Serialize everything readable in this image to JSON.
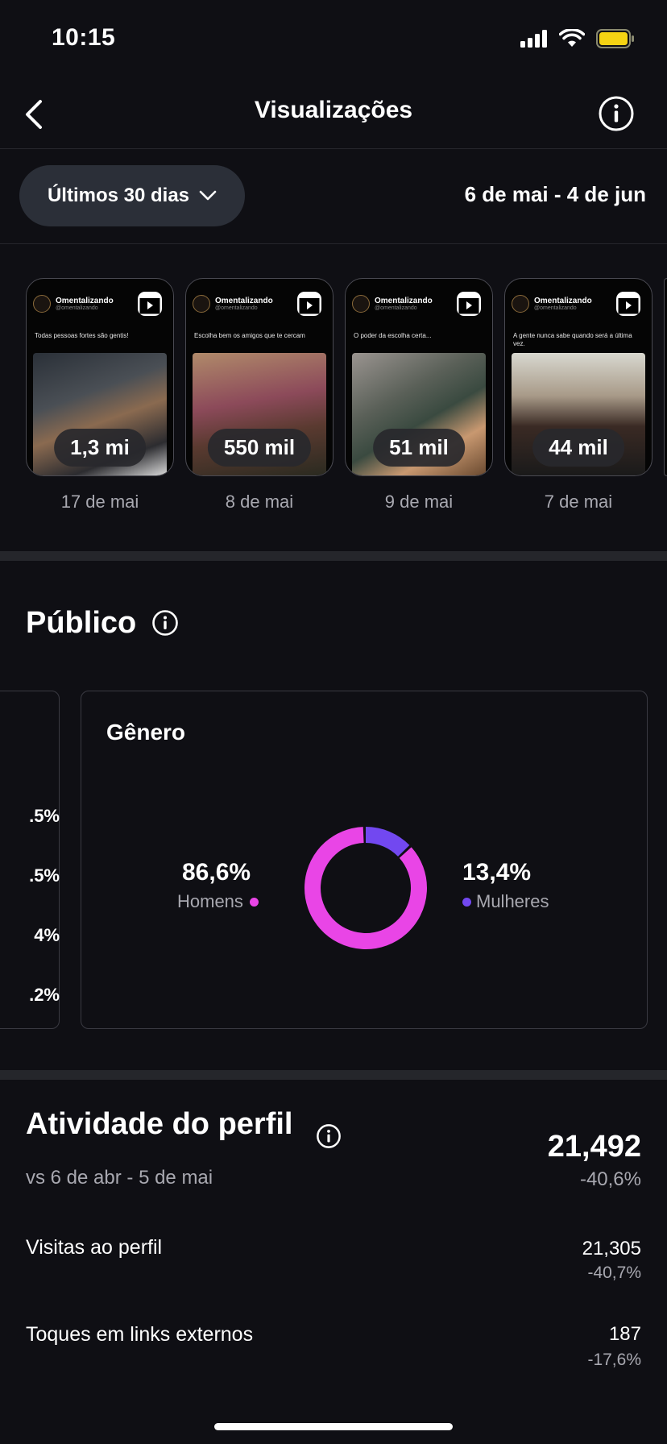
{
  "status": {
    "time": "10:15"
  },
  "nav": {
    "title": "Visualizações"
  },
  "filter": {
    "period": "Últimos 30 dias",
    "date_range": "6 de mai - 4 de jun"
  },
  "reels": [
    {
      "account": "Omentalizando",
      "handle": "@omentalizando",
      "caption": "Todas pessoas fortes são gentis!",
      "views": "1,3 mi",
      "date": "17 de mai"
    },
    {
      "account": "Omentalizando",
      "handle": "@omentalizando",
      "caption": "Escolha bem os amigos que te cercam",
      "views": "550 mil",
      "date": "8 de mai"
    },
    {
      "account": "Omentalizando",
      "handle": "@omentalizando",
      "caption": "O poder da escolha certa...",
      "views": "51 mil",
      "date": "9 de mai"
    },
    {
      "account": "Omentalizando",
      "handle": "@omentalizando",
      "caption": "A gente nunca sabe quando será a última vez.",
      "views": "44 mil",
      "date": "7 de mai"
    }
  ],
  "audience": {
    "title": "Público",
    "left_card_values": [
      ".5%",
      ".5%",
      "4%",
      ".2%"
    ],
    "gender": {
      "title": "Gênero",
      "men_pct": "86,6%",
      "men_label": "Homens",
      "women_pct": "13,4%",
      "women_label": "Mulheres",
      "men_share": 86.6,
      "women_share": 13.4,
      "men_color": "#e945e6",
      "women_color": "#7248f0"
    }
  },
  "activity": {
    "title": "Atividade do perfil",
    "compare": "vs 6 de abr - 5 de mai",
    "total": "21,492",
    "total_delta": "-40,6%",
    "rows": [
      {
        "label": "Visitas ao perfil",
        "value": "21,305",
        "delta": "-40,7%"
      },
      {
        "label": "Toques em links externos",
        "value": "187",
        "delta": "-17,6%"
      }
    ]
  }
}
